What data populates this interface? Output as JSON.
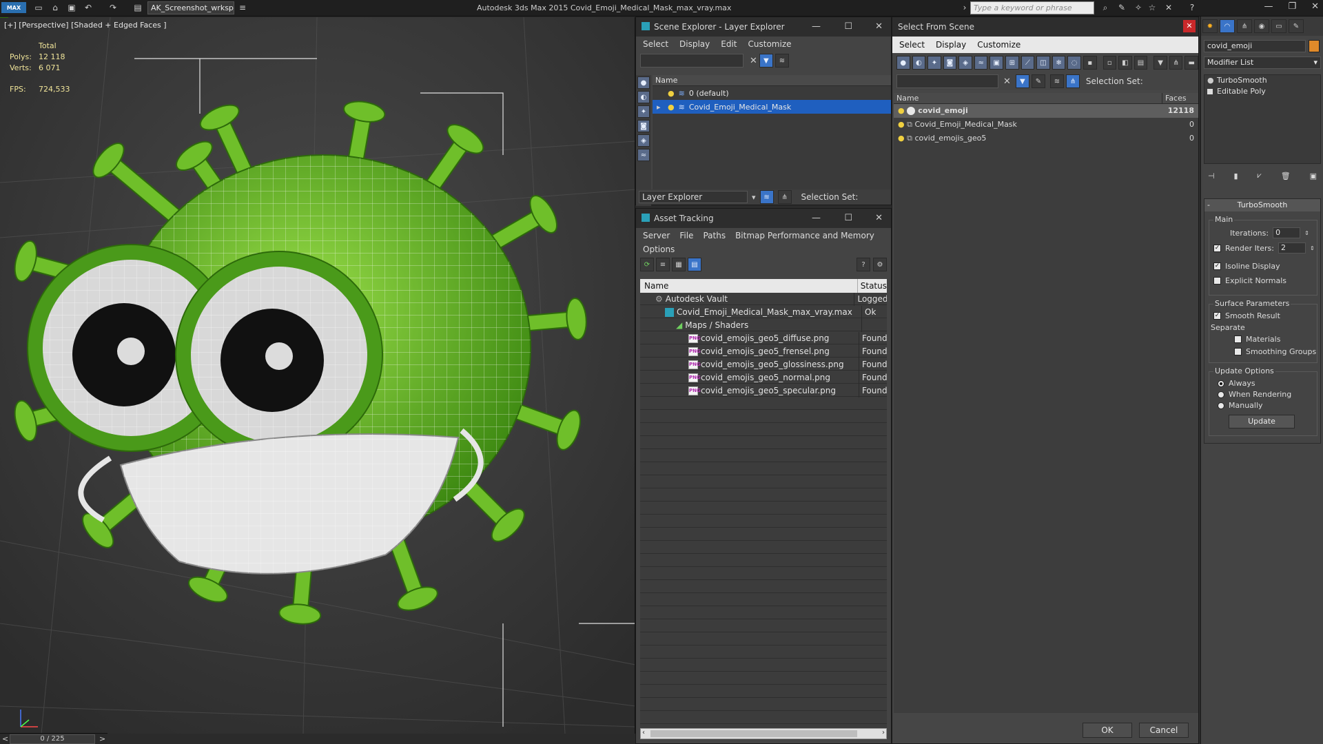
{
  "titlebar": {
    "app_logo": "MAX",
    "workspace": "AK_Screenshot_wrksp",
    "title": "Autodesk 3ds Max  2015     Covid_Emoji_Medical_Mask_max_vray.max",
    "search_placeholder": "Type a keyword or phrase"
  },
  "viewport": {
    "label": "[+] [Perspective] [Shaded + Edged Faces ]",
    "stats": {
      "total_label": "Total",
      "polys_label": "Polys:",
      "polys": "12 118",
      "verts_label": "Verts:",
      "verts": "6 071",
      "fps_label": "FPS:",
      "fps": "724,533"
    },
    "timeline": "0 / 225",
    "accent_green": "#6fbf2a",
    "wire_color": "#ffffff"
  },
  "scene_explorer": {
    "title": "Scene Explorer - Layer Explorer",
    "menu": [
      "Select",
      "Display",
      "Edit",
      "Customize"
    ],
    "column_name": "Name",
    "layers": [
      {
        "name": "0 (default)",
        "selected": false
      },
      {
        "name": "Covid_Emoji_Medical_Mask",
        "selected": true
      }
    ],
    "footer_dropdown": "Layer Explorer",
    "selection_set_label": "Selection Set:"
  },
  "asset_tracking": {
    "title": "Asset Tracking",
    "menu": [
      "Server",
      "File",
      "Paths",
      "Bitmap Performance and Memory",
      "Options"
    ],
    "col_name": "Name",
    "col_status": "Status",
    "rows": [
      {
        "name": "Autodesk Vault",
        "status": "Logged",
        "indent": 1,
        "icon": "vault"
      },
      {
        "name": "Covid_Emoji_Medical_Mask_max_vray.max",
        "status": "Ok",
        "indent": 2,
        "icon": "max"
      },
      {
        "name": "Maps / Shaders",
        "status": "",
        "indent": 3,
        "icon": "folder"
      },
      {
        "name": "covid_emojis_geo5_diffuse.png",
        "status": "Found",
        "indent": 4,
        "icon": "png"
      },
      {
        "name": "covid_emojis_geo5_frensel.png",
        "status": "Found",
        "indent": 4,
        "icon": "png"
      },
      {
        "name": "covid_emojis_geo5_glossiness.png",
        "status": "Found",
        "indent": 4,
        "icon": "png"
      },
      {
        "name": "covid_emojis_geo5_normal.png",
        "status": "Found",
        "indent": 4,
        "icon": "png"
      },
      {
        "name": "covid_emojis_geo5_specular.png",
        "status": "Found",
        "indent": 4,
        "icon": "png"
      }
    ]
  },
  "select_from_scene": {
    "title": "Select From Scene",
    "menu": [
      "Select",
      "Display",
      "Customize"
    ],
    "selection_set_label": "Selection Set:",
    "col_name": "Name",
    "col_faces": "Faces",
    "rows": [
      {
        "name": "covid_emoji",
        "faces": "12118",
        "selected": true
      },
      {
        "name": "Covid_Emoji_Medical_Mask",
        "faces": "0",
        "selected": false
      },
      {
        "name": "covid_emojis_geo5",
        "faces": "0",
        "selected": false
      }
    ],
    "ok_label": "OK",
    "cancel_label": "Cancel"
  },
  "command_panel": {
    "object_name": "covid_emoji",
    "modifier_list": "Modifier List",
    "stack": [
      "TurboSmooth",
      "Editable Poly"
    ],
    "rollout_title": "TurboSmooth",
    "main_label": "Main",
    "iterations_label": "Iterations:",
    "iterations": "0",
    "render_iters_label": "Render Iters:",
    "render_iters": "2",
    "isoline_label": "Isoline Display",
    "explicit_normals_label": "Explicit Normals",
    "surface_params_label": "Surface Parameters",
    "smooth_result_label": "Smooth Result",
    "separate_label": "Separate",
    "materials_label": "Materials",
    "smoothing_groups_label": "Smoothing Groups",
    "update_options_label": "Update Options",
    "always_label": "Always",
    "when_rendering_label": "When Rendering",
    "manually_label": "Manually",
    "update_button": "Update"
  }
}
